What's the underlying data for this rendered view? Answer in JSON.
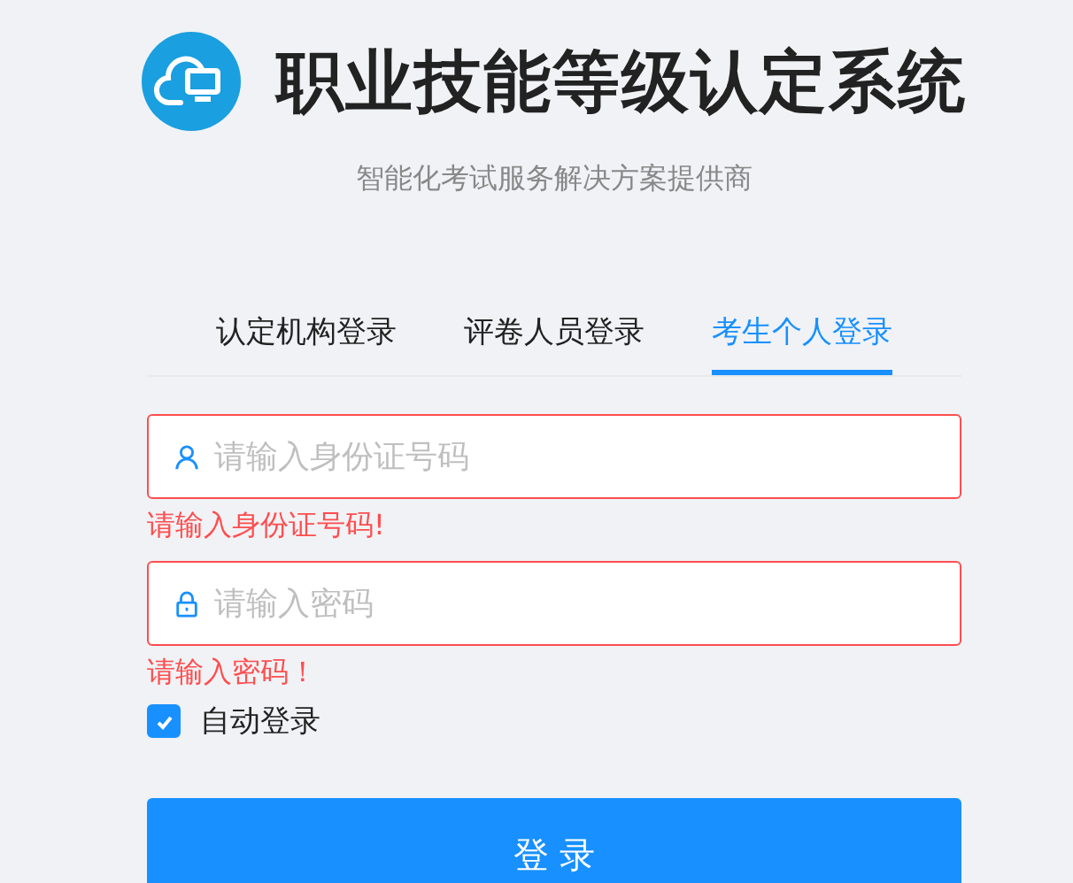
{
  "header": {
    "title": "职业技能等级认定系统",
    "subtitle": "智能化考试服务解决方案提供商"
  },
  "tabs": [
    {
      "label": "认定机构登录",
      "selected": false
    },
    {
      "label": "评卷人员登录",
      "selected": false
    },
    {
      "label": "考生个人登录",
      "selected": true
    }
  ],
  "fields": [
    {
      "kind": "user",
      "placeholder": "请输入身份证号码",
      "error": "请输入身份证号码!"
    },
    {
      "kind": "password",
      "placeholder": "请输入密码",
      "error": "请输入密码！"
    }
  ],
  "remember": {
    "label": "自动登录",
    "checked": true
  },
  "submit": {
    "label": "登 录"
  }
}
